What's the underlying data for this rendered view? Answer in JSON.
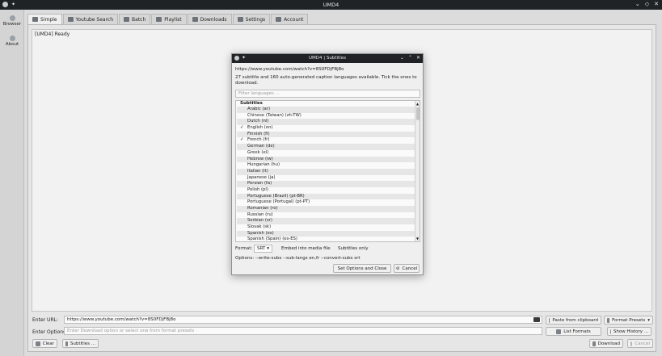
{
  "window": {
    "title": "UMD4"
  },
  "sidebar": {
    "items": [
      {
        "label": "Browser"
      },
      {
        "label": "About"
      }
    ]
  },
  "tabs": [
    {
      "label": "Simple"
    },
    {
      "label": "Youtube Search"
    },
    {
      "label": "Batch"
    },
    {
      "label": "Playlist"
    },
    {
      "label": "Downloads"
    },
    {
      "label": "Settings"
    },
    {
      "label": "Account"
    }
  ],
  "log": {
    "text": "[UMD4] Ready"
  },
  "bottom": {
    "url_label": "Enter URL:",
    "url_value": "https://www.youtube.com/watch?v=8S0FDjFBj8o",
    "options_label": "Enter Options:",
    "options_placeholder": "Enter Download option or select one from format presets",
    "paste_button": "Paste from clipboard",
    "presets_button": "Format Presets",
    "list_formats_button": "List Formats",
    "history_button": "Show History ...",
    "clear_button": "Clear",
    "subtitles_button": "Subtitles ...",
    "download_button": "Download",
    "cancel_button": "Cancel"
  },
  "dialog": {
    "title": "UMD4 | Subtitles",
    "url": "https://www.youtube.com/watch?v=8S0FDjFBj8o",
    "info_line1": "27 subtitle and 160 auto-generated caption languages available. Tick the ones to",
    "info_line2": "download.",
    "filter_placeholder": "Filter languages ...",
    "list_header": "Subtitles",
    "languages": [
      {
        "label": "Arabic  (ar)",
        "checked": false
      },
      {
        "label": "Chinese (Taiwan)  (zh-TW)",
        "checked": false
      },
      {
        "label": "Dutch  (nl)",
        "checked": false
      },
      {
        "label": "English  (en)",
        "checked": true
      },
      {
        "label": "Finnish  (fi)",
        "checked": false
      },
      {
        "label": "French  (fr)",
        "checked": true
      },
      {
        "label": "German  (de)",
        "checked": false
      },
      {
        "label": "Greek  (el)",
        "checked": false
      },
      {
        "label": "Hebrew  (iw)",
        "checked": false
      },
      {
        "label": "Hungarian  (hu)",
        "checked": false
      },
      {
        "label": "Italian  (it)",
        "checked": false
      },
      {
        "label": "Japanese  (ja)",
        "checked": false
      },
      {
        "label": "Persian  (fa)",
        "checked": false
      },
      {
        "label": "Polish  (pl)",
        "checked": false
      },
      {
        "label": "Portuguese (Brazil)  (pt-BR)",
        "checked": false
      },
      {
        "label": "Portuguese (Portugal)  (pt-PT)",
        "checked": false
      },
      {
        "label": "Romanian  (ro)",
        "checked": false
      },
      {
        "label": "Russian  (ru)",
        "checked": false
      },
      {
        "label": "Serbian  (sr)",
        "checked": false
      },
      {
        "label": "Slovak  (sk)",
        "checked": false
      },
      {
        "label": "Spanish  (es)",
        "checked": false
      },
      {
        "label": "Spanish (Spain)  (es-ES)",
        "checked": false
      }
    ],
    "format_label": "Format:",
    "format_value": "SRT",
    "embed_label": "Embed into media file",
    "subs_only_label": "Subtitles only",
    "options_text": "Options: --write-subs --sub-langs en,fr --convert-subs srt",
    "ok_button": "Set Options and Close",
    "cancel_button": "Cancel"
  }
}
